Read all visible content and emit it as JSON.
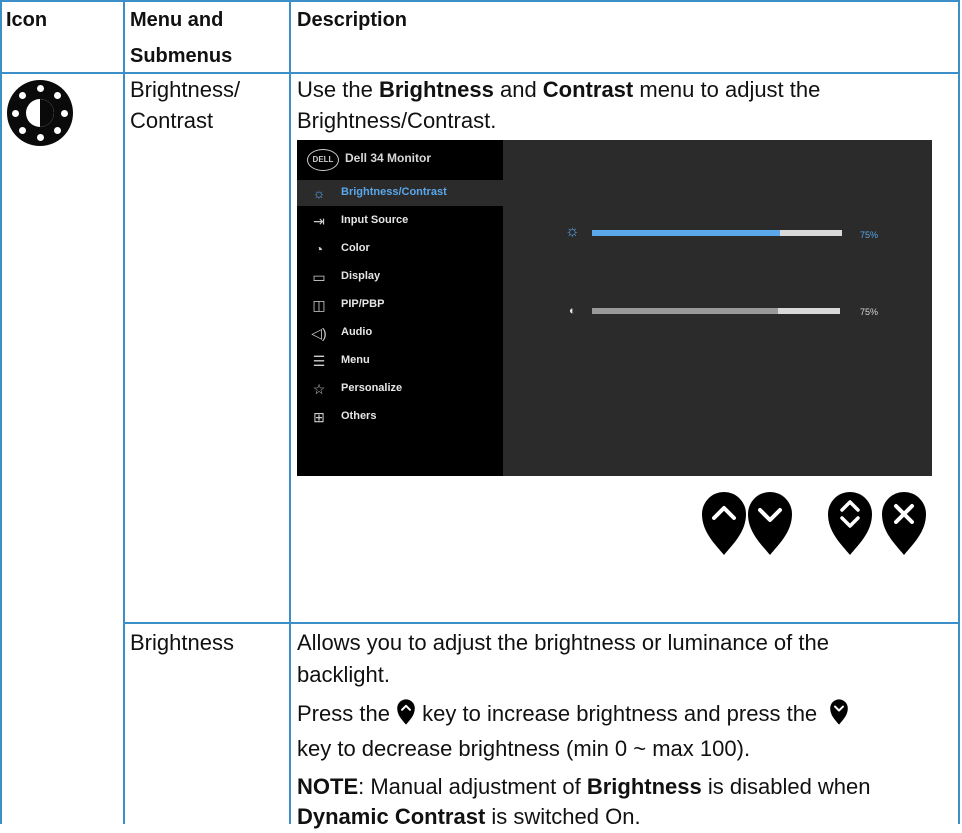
{
  "table": {
    "headers": {
      "icon": "Icon",
      "menu_line1": "Menu and",
      "menu_line2": "Submenus",
      "description": "Description"
    },
    "rows": [
      {
        "menu_line1": "Brightness/",
        "menu_line2": "Contrast",
        "desc_line1_prefix": "Use the ",
        "desc_line1_bold1": "Brightness",
        "desc_line1_mid": " and ",
        "desc_line1_bold2": "Contrast",
        "desc_line1_suffix": " menu to adjust the",
        "desc_line2": "Brightness/Contrast."
      },
      {
        "menu": "Brightness",
        "desc_p1_line1": "Allows you to adjust the brightness or luminance of the",
        "desc_p1_line2": "backlight.",
        "desc_p2_part1": "Press the ",
        "desc_p2_part2": " key to increase brightness and press the ",
        "desc_p2_line2": "key to decrease brightness (min 0 ~ max 100).",
        "note_label": "NOTE",
        "note_part1": ": Manual adjustment of ",
        "note_bold": "Brightness",
        "note_part2": " is disabled when",
        "note_line2_bold": "Dynamic Contrast",
        "note_line2_rest": " is switched On."
      }
    ]
  },
  "osd": {
    "logo": "DELL",
    "title": "Dell 34 Monitor",
    "menu_items": [
      {
        "label": "Brightness/Contrast",
        "icon": "brightness-icon",
        "selected": true
      },
      {
        "label": "Input Source",
        "icon": "input-source-icon",
        "selected": false
      },
      {
        "label": "Color",
        "icon": "color-palette-icon",
        "selected": false
      },
      {
        "label": "Display",
        "icon": "display-icon",
        "selected": false
      },
      {
        "label": "PIP/PBP",
        "icon": "pip-pbp-icon",
        "selected": false
      },
      {
        "label": "Audio",
        "icon": "audio-icon",
        "selected": false
      },
      {
        "label": "Menu",
        "icon": "menu-icon",
        "selected": false
      },
      {
        "label": "Personalize",
        "icon": "star-icon",
        "selected": false
      },
      {
        "label": "Others",
        "icon": "others-icon",
        "selected": false
      }
    ],
    "brightness": {
      "value": 75,
      "label": "75%",
      "color": "#5aa7ea"
    },
    "contrast": {
      "value": 75,
      "label": "75%",
      "color": "#9a9a9a"
    }
  },
  "nav_keys": [
    {
      "name": "up-key-icon"
    },
    {
      "name": "down-key-icon"
    },
    {
      "name": "up-down-key-icon"
    },
    {
      "name": "exit-key-icon"
    }
  ],
  "colors": {
    "grid": "#3d8fc7",
    "osd_accent": "#5aa7ea"
  }
}
